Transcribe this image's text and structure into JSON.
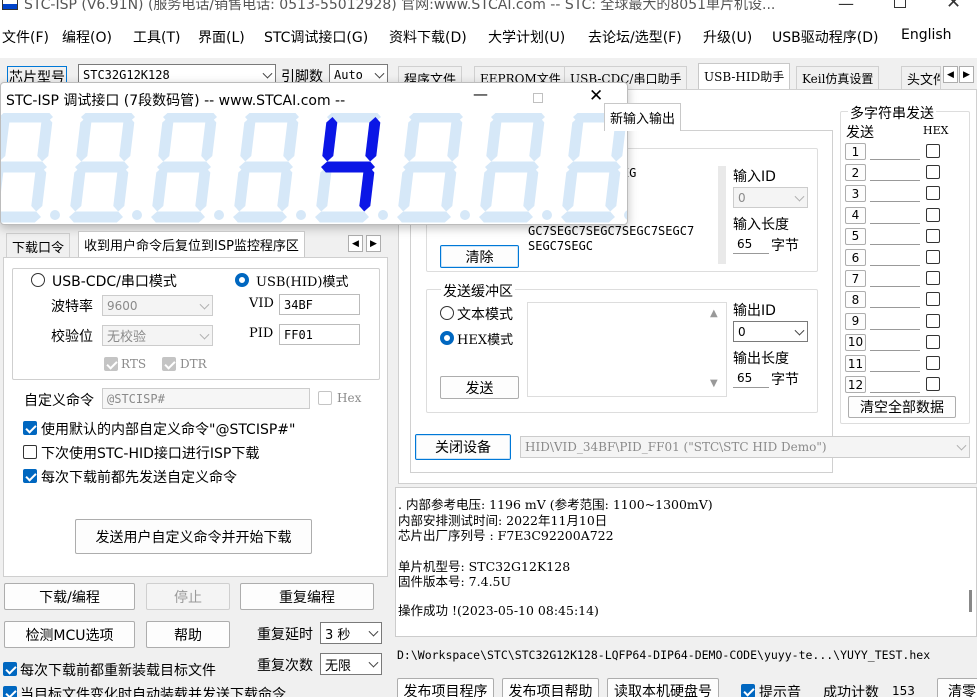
{
  "titlebar": {
    "title": "STC-ISP (V6.91N) (服务电话/销售电话: 0513-55012928) 官网:www.STCAI.com  -- STC: 全球最大的8051单片机设..."
  },
  "menu": [
    "文件(F)",
    "编程(O)",
    "工具(T)",
    "界面(L)",
    "STC调试接口(G)",
    "资料下载(D)",
    "大学计划(U)",
    "去论坛/选型(F)",
    "升级(U)",
    "USB驱动程序(D)",
    "English"
  ],
  "chip": {
    "label": "芯片型号",
    "value": "STC32G12K128",
    "pin_label": "引脚数",
    "pin_value": "Auto"
  },
  "left_tabs": [
    "下载口令",
    "收到用户命令后复位到ISP监控程序区"
  ],
  "mode": {
    "cdc_label": "USB-CDC/串口模式",
    "hid_label": "USB(HID)模式",
    "baud_label": "波特率",
    "baud_value": "9600",
    "parity_label": "校验位",
    "parity_value": "无校验",
    "rts": "RTS",
    "dtr": "DTR",
    "vid_label": "VID",
    "vid_value": "34BF",
    "pid_label": "PID",
    "pid_value": "FF01"
  },
  "custom_cmd": {
    "label": "自定义命令",
    "value": "@STCISP#",
    "hex": "Hex"
  },
  "options": [
    {
      "label": "使用默认的内部自定义命令\"@STCISP#\"",
      "checked": true
    },
    {
      "label": "下次使用STC-HID接口进行ISP下载",
      "checked": false
    },
    {
      "label": "每次下载前都先发送自定义命令",
      "checked": true
    }
  ],
  "send_start_button": "发送用户自定义命令并开始下载",
  "bottom_buttons": {
    "download": "下载/编程",
    "stop": "停止",
    "reprogram": "重复编程",
    "check_mcu": "检测MCU选项",
    "help": "帮助",
    "delay_label": "重复延时",
    "delay_value": "3 秒",
    "count_label": "重复次数",
    "count_value": "无限"
  },
  "bottom_checks": [
    {
      "label": "每次下载前都重新装载目标文件",
      "checked": true
    },
    {
      "label": "当目标文件变化时自动装载并发送下载命令",
      "checked": true
    }
  ],
  "right_tabs": [
    "程序文件",
    "EEPROM文件",
    "USB-CDC/串口助手",
    "USB-HID助手",
    "Keil仿真设置",
    "头文件"
  ],
  "hid": {
    "sub_tab": "新输入输出",
    "recv_text": "C7SEGC7SEGC7SEG\nEGC7SEGC7S\n7SEGC7SEGC\nGC7SEGC7SE\nGC7SEGC7SEGC7SEGC7SEGC7\nSEGC7SEGC",
    "in_id_label": "输入ID",
    "in_id_value": "0",
    "in_len_label": "输入长度",
    "in_len_value": "65",
    "in_len_unit": "字节",
    "clear_button": "清除",
    "send_buffer_title": "发送缓冲区",
    "text_mode": "文本模式",
    "hex_mode": "HEX模式",
    "out_id_label": "输出ID",
    "out_id_value": "0",
    "out_len_label": "输出长度",
    "out_len_value": "65",
    "out_len_unit": "字节",
    "send_button": "发送",
    "close_device_button": "关闭设备",
    "device_path": "HID\\VID_34BF\\PID_FF01 (\"STC\\STC HID Demo\")"
  },
  "multi_send": {
    "title": "多字符串发送",
    "send_col": "发送",
    "hex_col": "HEX",
    "rows": [
      "1",
      "2",
      "3",
      "4",
      "5",
      "6",
      "7",
      "8",
      "9",
      "10",
      "11",
      "12"
    ],
    "clear_all": "清空全部数据"
  },
  "log": {
    "line1": ". 内部参考电压: 1196 mV (参考范围: 1100~1300mV)",
    "line2": "  内部安排测试时间: 2022年11月10日",
    "line3": "芯片出厂序列号 : F7E3C92200A722",
    "line4": "  单片机型号: STC32G12K128",
    "line5": "  固件版本号: 7.4.5U",
    "line6": "操作成功 !(2023-05-10 08:45:14)"
  },
  "file_path": "D:\\Workspace\\STC\\STC32G12K128-LQFP64-DIP64-DEMO-CODE\\yuyy-te...\\YUYY_TEST.hex",
  "footer": {
    "publish_program": "发布项目程序",
    "publish_help": "发布项目帮助",
    "read_disk": "读取本机硬盘号",
    "beep_label": "提示音",
    "success_label": "成功计数",
    "success_value": "153",
    "clear_label": "清零"
  },
  "seg_window": {
    "title": "STC-ISP 调试接口 (7段数码管) -- www.STCAI.com --",
    "digits": [
      "8",
      "8",
      "8",
      "8",
      "4",
      "8",
      "8",
      "8"
    ],
    "active_digit": 4,
    "lit_digit_value": "4",
    "lit_color": "#0b16e6",
    "dim_color": "#d6e8f8"
  }
}
